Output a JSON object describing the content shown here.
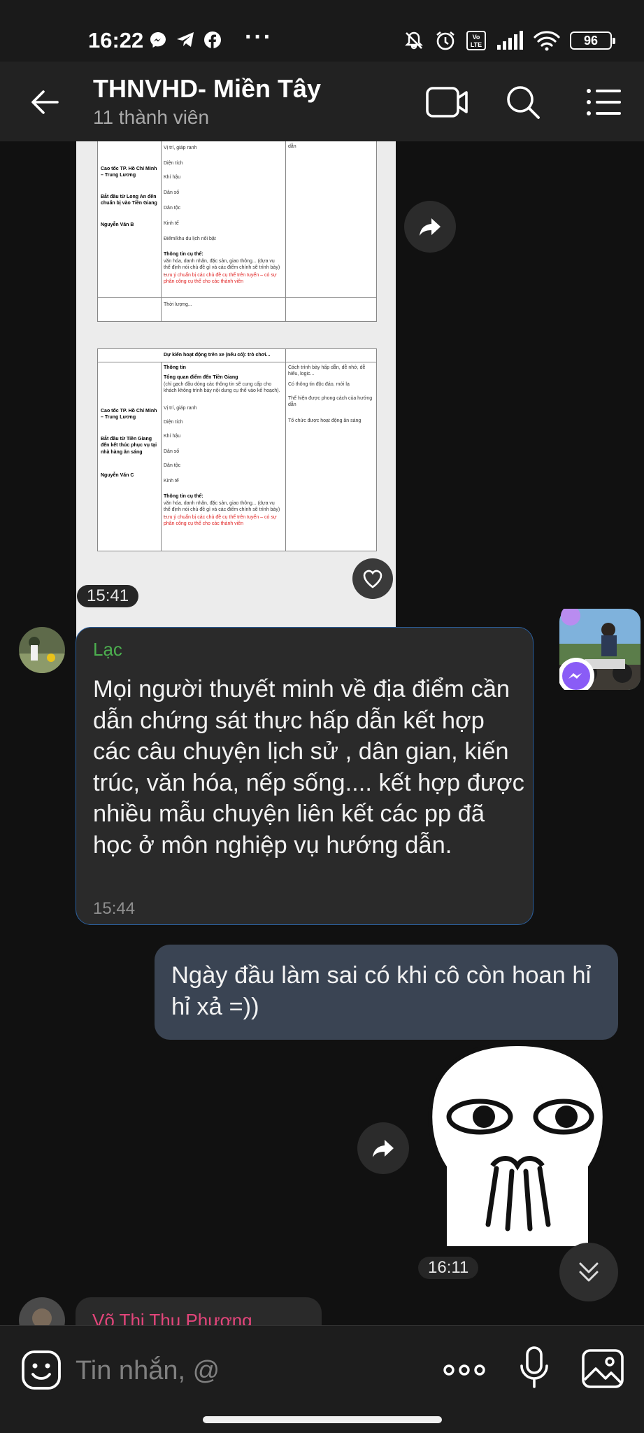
{
  "status_bar": {
    "time": "16:22",
    "left_icons": [
      "messenger-icon",
      "telegram-icon",
      "facebook-icon"
    ],
    "more": "···",
    "right_icons": [
      "mute-icon",
      "alarm-icon",
      "volte-icon",
      "signal-icon",
      "wifi-icon"
    ],
    "volte_label": "Vo LTE",
    "battery": "96"
  },
  "header": {
    "title": "THNVHD- Miền Tây",
    "subtitle": "11 thành viên",
    "icons": [
      "back-arrow-icon",
      "video-call-icon",
      "search-icon",
      "menu-icon"
    ]
  },
  "doc_image": {
    "page1": {
      "col1_bold": [
        "Cao tốc TP. Hồ Chí Minh – Trung Lương",
        "Bắt đầu từ Long An đến chuẩn bị vào Tiền Giang",
        "Nguyễn Văn B"
      ],
      "col2": [
        "Vị trí, giáp ranh",
        "Diện tích",
        "Khí hậu",
        "Dân số",
        "Dân tộc",
        "Kinh tế",
        "Điểm/khu du lịch nổi bật"
      ],
      "col2_bold": "Thông tin cụ thể:",
      "col2_detail": "văn hóa, danh nhân, đặc sản, giao thông... (dựa vụ thể định nói chủ đề gì và các điểm chính sẽ trình bày) –",
      "col2_red": "Lưu ý chuẩn bị các chủ đề cụ thể trên tuyến – có sự phân công cụ thể cho các thành viên",
      "col2_end": "Thời lượng...",
      "col3": "dẫn"
    },
    "page2": {
      "top_row": "Dự kiến hoạt động trên xe (nếu có): trò chơi...",
      "col1_bold": [
        "Cao tốc TP. Hồ Chí Minh – Trung Lương",
        "Bắt đầu từ Tiền Giang đến kết thúc phục vụ tại nhà hàng ăn sáng",
        "Nguyễn Văn C"
      ],
      "col2_title": "Thông tin",
      "col2_bold": "Tổng quan điểm đến Tiền Giang",
      "col2_intro": "(chỉ gạch đầu dòng các thông tin sẽ cung cấp cho khách không trình bày nội dung cụ thể vào kế hoạch).",
      "col2": [
        "Vị trí, giáp ranh",
        "Diện tích",
        "Khí hậu",
        "Dân số",
        "Dân tộc",
        "Kinh tế"
      ],
      "col2_bold2": "Thông tin cụ thể:",
      "col2_detail": "văn hóa, danh nhân, đặc sản, giao thông... (dựa vụ thể định nói chủ đề gì và các điểm chính sẽ trình bày) –",
      "col2_red": "Lưu ý chuẩn bị các chủ đề cụ thể trên tuyến – có sự phân công cụ thể cho các thành viên",
      "col3": [
        "Cách trình bày hấp dẫn, dễ nhớ, dễ hiểu, logic...",
        "Có thông tin độc đáo, mới lạ",
        "Thể hiện được phong cách của hướng dẫn",
        "Tổ chức được hoạt động ăn sáng"
      ]
    }
  },
  "messages": [
    {
      "id": "m1",
      "type": "image",
      "time": "15:41"
    },
    {
      "id": "m2",
      "sender": "Lạc",
      "text": "Mọi người thuyết minh về địa điểm cần dẫn chứng sát thực hấp dẫn kết hợp các câu chuyện lịch sử , dân gian, kiến trúc, văn hóa, nếp sống.... kết hợp được nhiều mẫu chuyện liên kết các pp đã học ở môn nghiệp vụ hướng dẫn.",
      "time": "15:44"
    },
    {
      "id": "m3",
      "outgoing": true,
      "text": "Ngày đầu làm sai có khi cô còn hoan hỉ hỉ xả =))"
    },
    {
      "id": "m4",
      "type": "sticker",
      "time": "16:11"
    },
    {
      "id": "m5",
      "sender": "Võ Thị Thu Phương"
    }
  ],
  "composer": {
    "placeholder": "Tin nhắn, @",
    "icons": [
      "emoji-icon",
      "more-dots-icon",
      "microphone-icon",
      "gallery-icon"
    ]
  },
  "colors": {
    "background": "#111111",
    "header": "#222222",
    "incoming_bubble": "#2a2a2a",
    "incoming_border": "#2a5f9e",
    "outgoing_bubble": "#3a4453",
    "sender_green": "#4cae4f",
    "sender_pink": "#e2457a"
  }
}
